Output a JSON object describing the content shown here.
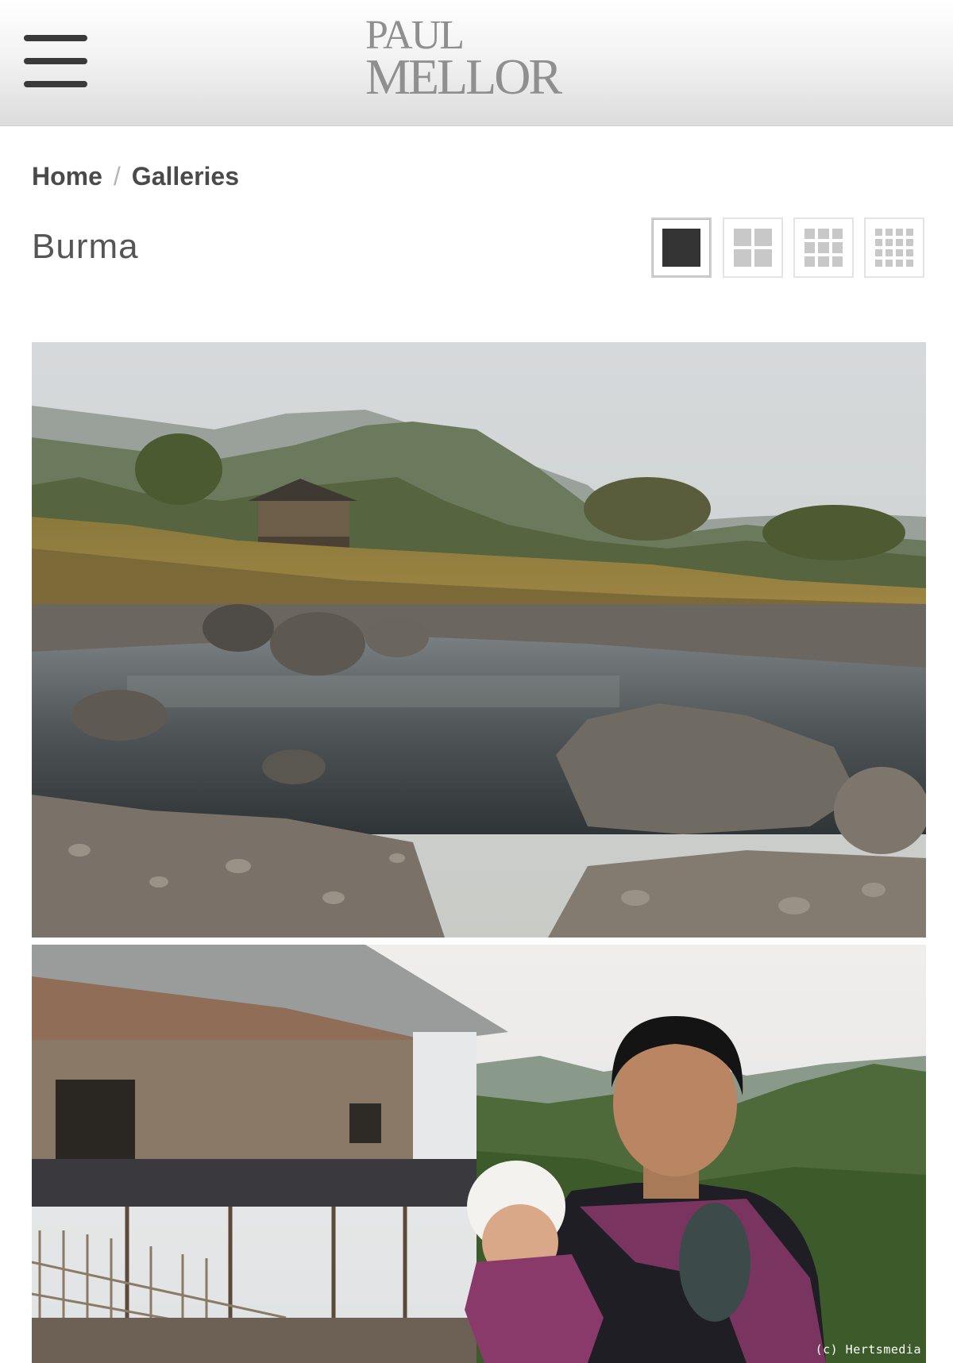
{
  "header": {
    "logo_line1": "PAUL",
    "logo_line2": "MELLOR"
  },
  "breadcrumb": {
    "items": [
      "Home",
      "Galleries"
    ],
    "separator": "/"
  },
  "gallery": {
    "title": "Burma"
  },
  "layout_options": [
    {
      "label": "1 column",
      "active": true
    },
    {
      "label": "2 columns",
      "active": false
    },
    {
      "label": "3 columns",
      "active": false
    },
    {
      "label": "4 columns",
      "active": false
    }
  ],
  "photos": [
    {
      "subject": "river-landscape"
    },
    {
      "subject": "woman-with-baby"
    }
  ],
  "watermark": "(c) Hertsmedia",
  "colors": {
    "text": "#4a4a4a",
    "logo": "#8f8f8f",
    "active_layout": "#333333",
    "inactive_layout": "#c8c8c8"
  }
}
